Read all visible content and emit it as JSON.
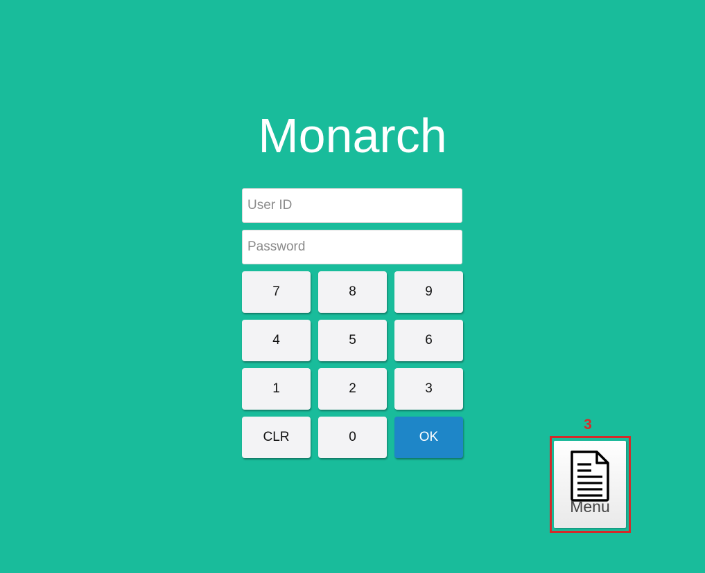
{
  "app": {
    "title": "Monarch"
  },
  "login": {
    "user_id_placeholder": "User ID",
    "password_placeholder": "Password"
  },
  "keypad": {
    "keys": [
      "7",
      "8",
      "9",
      "4",
      "5",
      "6",
      "1",
      "2",
      "3",
      "CLR",
      "0",
      "OK"
    ]
  },
  "menu": {
    "label": "Menu",
    "icon": "document-icon"
  },
  "annotation": {
    "number": "3"
  },
  "colors": {
    "background": "#19bc9b",
    "ok_button": "#1e86c8",
    "key_button": "#f3f3f5",
    "annotation": "#d42a2a"
  }
}
